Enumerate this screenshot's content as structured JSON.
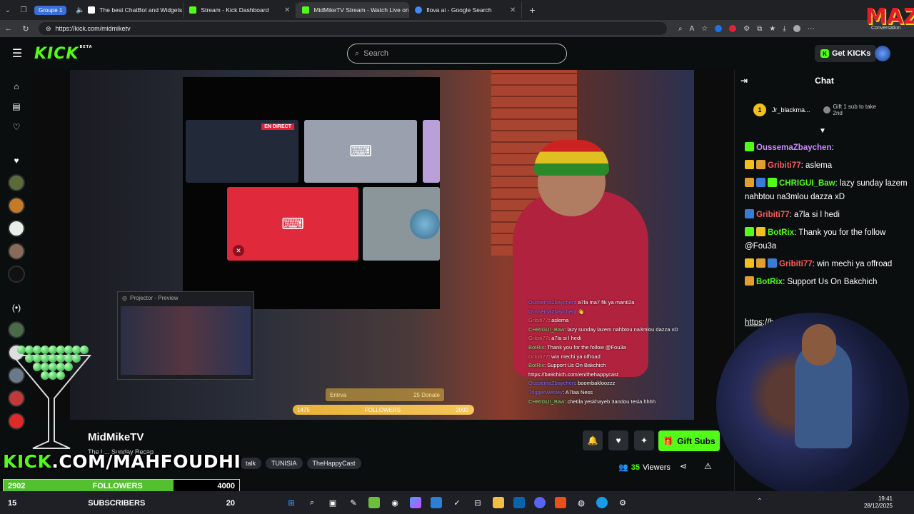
{
  "browser": {
    "group_label": "Groupe 1",
    "tabs": [
      {
        "title": "The best ChatBot and Widgets",
        "fav_color": "#ffffff"
      },
      {
        "title": "Stream - Kick Dashboard",
        "fav_color": "#53fc18"
      },
      {
        "title": "MidMikeTV Stream - Watch Live on",
        "fav_color": "#53fc18"
      },
      {
        "title": "flova ai - Google Search",
        "fav_color": "#4285f4"
      }
    ],
    "url": "https://kick.com/midmiketv"
  },
  "overlay_logo": {
    "text": "MAZ",
    "caption": "Conversation"
  },
  "header": {
    "logo": "KICK",
    "logo_sup": "BETA",
    "search_placeholder": "Search",
    "get_kicks": "Get KICKs"
  },
  "video": {
    "en_direct": "EN DIRECT",
    "projector_title": "Projector - Preview",
    "entrava_left": "Entrva",
    "entrava_right": "25 Donate",
    "followers_goal": {
      "current": "1475",
      "label": "FOLLOWERS",
      "target": "2000",
      "progress": 0.7
    },
    "chat_lines": [
      {
        "user": "OussemaZbaychen",
        "text": ": a7la ma7 fik ya manti2a",
        "cls": "n"
      },
      {
        "user": "OussemaZbaychen",
        "text": ": 👋",
        "cls": "n"
      },
      {
        "user": "Gribiti77",
        "text": ": aslema",
        "cls": "r"
      },
      {
        "user": "CHRIGUI_Baw",
        "text": ": lazy sunday lazem nahbtou na3mlou dazza xD",
        "cls": "g"
      },
      {
        "user": "Gribiti77",
        "text": ": a7la si l hedi",
        "cls": "r"
      },
      {
        "user": "BotRix",
        "text": ": Thank you for the follow @Fou3a",
        "cls": "g"
      },
      {
        "user": "Gribiti77",
        "text": ": win mechi ya offroad",
        "cls": "r"
      },
      {
        "user": "BotRix",
        "text": ": Support Us On Bakchich https://ba9chich.com/en/thehappycast",
        "cls": "g"
      },
      {
        "user": "OussemaZbaychen",
        "text": ": boombakloozzz",
        "cls": "n"
      },
      {
        "user": "TriggerWesley",
        "text": ": A7laa Ness",
        "cls": "n"
      },
      {
        "user": "CHRIGUI_Baw",
        "text": ": chetila yeskhayeb 3andou tesla hhhh",
        "cls": "g"
      }
    ]
  },
  "channel": {
    "name": "MidMikeTV",
    "subtitle": "The L... Sunday Recap",
    "tags": [
      "talk",
      "TUNISIA",
      "TheHappyCast"
    ],
    "gift_subs": "Gift Subs",
    "viewers_count": "35",
    "viewers_label": "Viewers"
  },
  "overlay_widgets": {
    "kick_url_a": "KICK",
    "kick_url_b": ".COM/MAHFOUDHI",
    "followers": {
      "current": "2902",
      "label": "FOLLOWERS",
      "target": "4000",
      "progress": 0.72,
      "color": "#53c12f"
    },
    "subscribers": {
      "current": "15",
      "label": "SUBSCRIBERS",
      "target": "20",
      "progress": 0.75,
      "color": "#f06fd1"
    }
  },
  "chat": {
    "title": "Chat",
    "pinned_user": "Jr_blackma...",
    "pinned_count": "1",
    "gift_text": "Gift 1 sub to take 2nd",
    "messages": [
      {
        "user": "OussemaZbaychen",
        "text": ":",
        "cls": "u1"
      },
      {
        "user": "Gribiti77",
        "text": ": aslema",
        "cls": "u2"
      },
      {
        "user": "CHRIGUI_Baw",
        "text": ": lazy sunday lazem nahbtou na3mlou dazza xD",
        "cls": "u3"
      },
      {
        "user": "Gribiti77",
        "text": ": a7la si l hedi",
        "cls": "u2"
      },
      {
        "user": "BotRix",
        "text": ": Thank you for the follow @Fou3a",
        "cls": "u3"
      },
      {
        "user": "Gribiti77",
        "text": ": win mechi ya offroad",
        "cls": "u2"
      },
      {
        "user": "BotRix",
        "text": ": Support Us On Bakchich",
        "cls": "u3"
      }
    ],
    "link_line": "https://b... ...happycast"
  },
  "taskbar": {
    "time": "19:41",
    "date": "28/12/2025"
  }
}
